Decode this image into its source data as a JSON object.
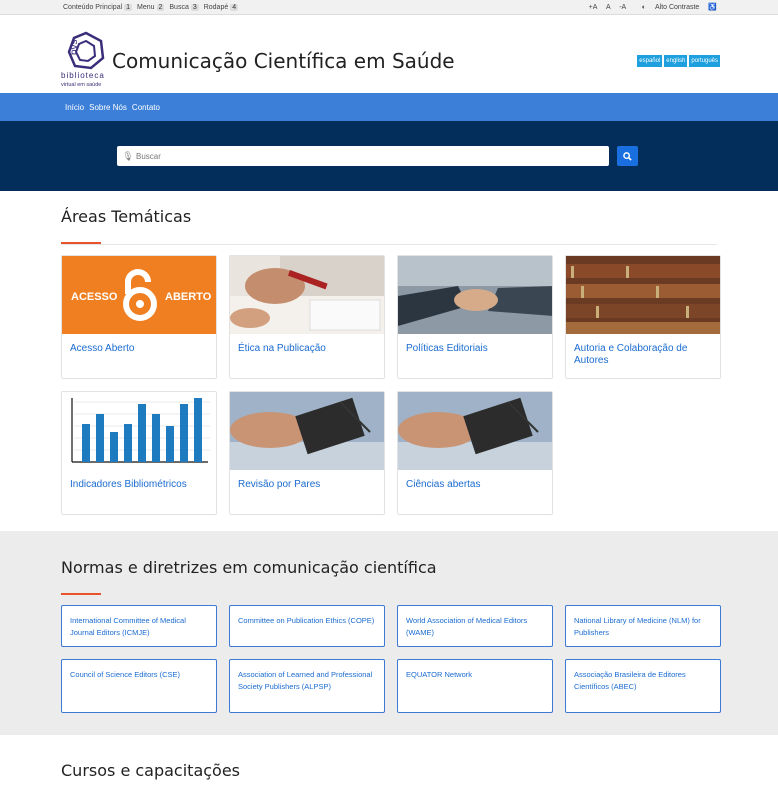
{
  "topbar": {
    "skip_links": [
      {
        "label": "Conteúdo Principal",
        "key": "1"
      },
      {
        "label": "Menu",
        "key": "2"
      },
      {
        "label": "Busca",
        "key": "3"
      },
      {
        "label": "Rodapé",
        "key": "4"
      }
    ],
    "font_up": "+A",
    "font_normal": "A",
    "font_down": "-A",
    "contrast": "Alto Contraste"
  },
  "header": {
    "logo_text": "bvs",
    "logo_sub1": "biblioteca",
    "logo_sub2": "virtual em saúde",
    "title": "Comunicação Científica em Saúde",
    "languages": [
      "español",
      "english",
      "português"
    ]
  },
  "nav": {
    "items": [
      "Início",
      "Sobre Nós",
      "Contato"
    ]
  },
  "search": {
    "placeholder": "Buscar"
  },
  "areas": {
    "title": "Áreas Temáticas",
    "items": [
      {
        "label": "Acesso Aberto",
        "img_text_left": "ACESSO",
        "img_text_right": "ABERTO"
      },
      {
        "label": "Ética na Publicação"
      },
      {
        "label": "Políticas Editoriais"
      },
      {
        "label": "Autoria e Colaboração de Autores"
      },
      {
        "label": "Indicadores Bibliométricos"
      },
      {
        "label": "Revisão por Pares"
      },
      {
        "label": "Ciências abertas"
      }
    ]
  },
  "normas": {
    "title": "Normas e diretrizes em comunicação científica",
    "items": [
      "International Committee of Medical Journal Editors (ICMJE)",
      "Committee on Publication Ethics (COPE)",
      "World Association of Medical Editors (WAME)",
      "National Library of Medicine (NLM) for Publishers",
      "Council of Science Editors (CSE)",
      "Association of Learned and Professional Society Publishers (ALPSP)",
      "EQUATOR Network",
      "Associação Brasileira de Editores Científicos (ABEC)"
    ]
  },
  "cursos": {
    "title": "Cursos e capacitações"
  },
  "colors": {
    "accent": "#3b7fd8",
    "hero": "#032d5b",
    "underline": "#e8532b",
    "link": "#1a6bd1",
    "orange": "#f07f22"
  }
}
